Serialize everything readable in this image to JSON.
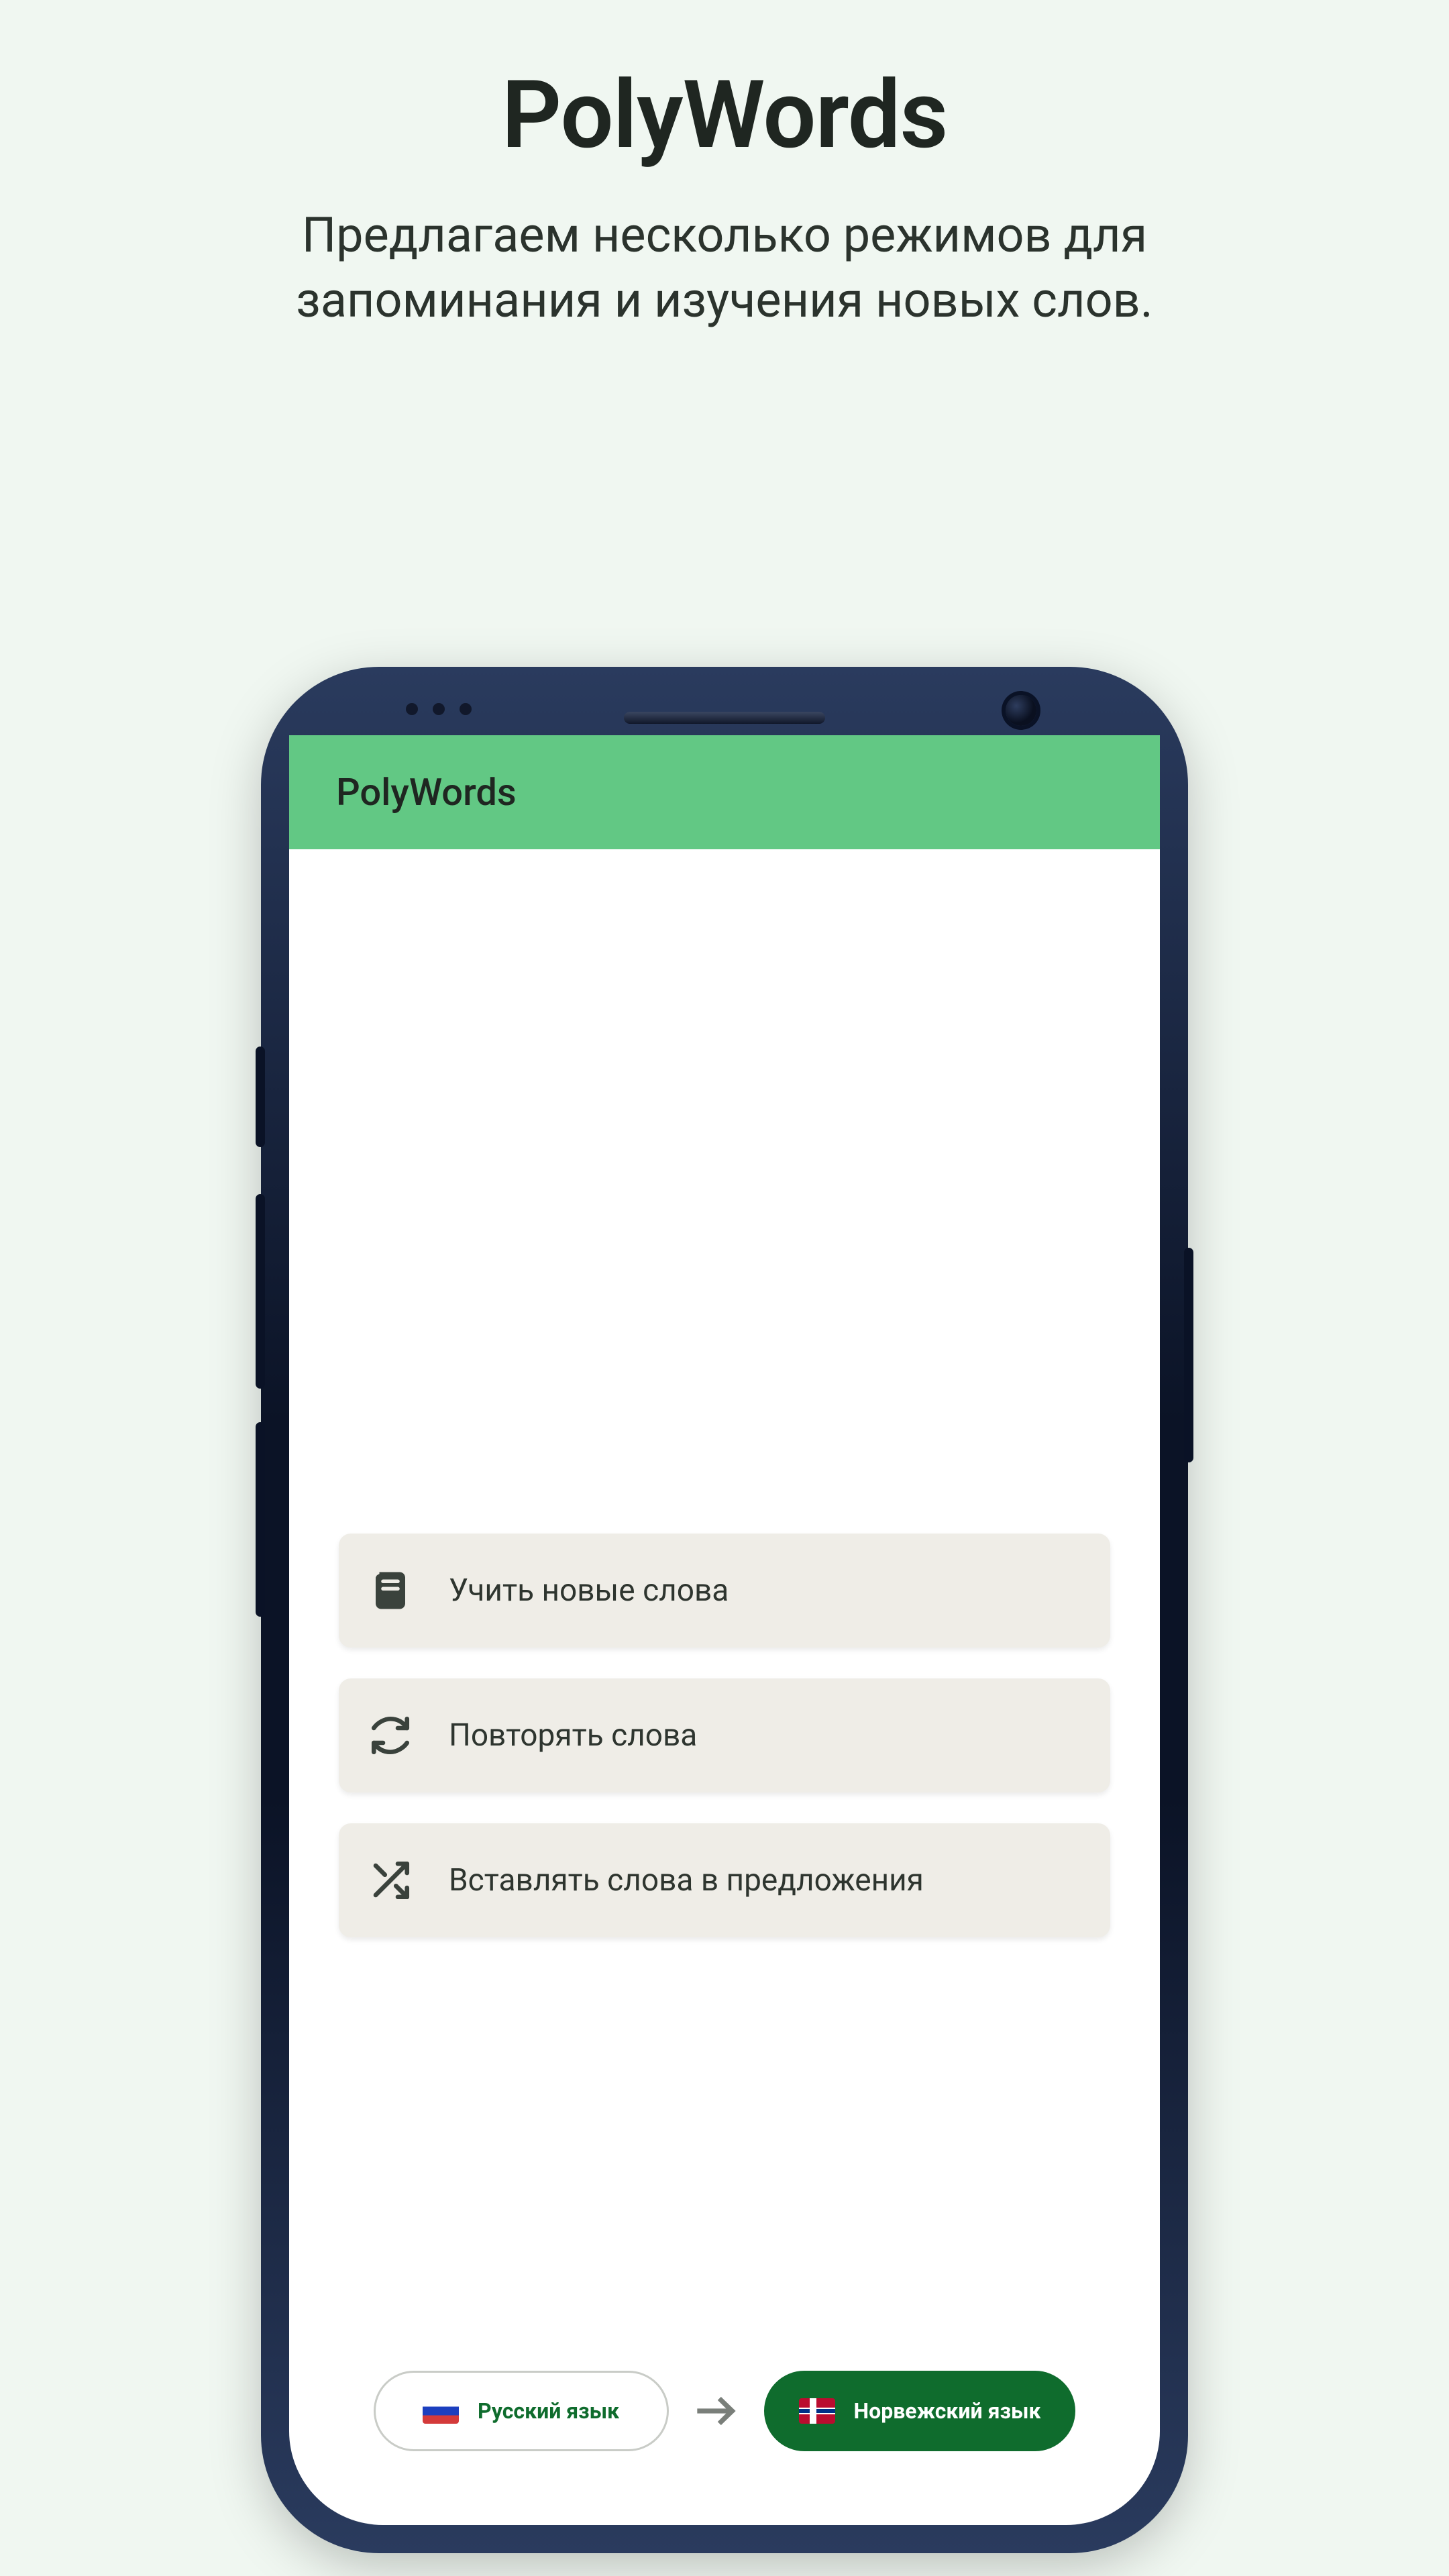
{
  "promo": {
    "title": "PolyWords",
    "subtitle": "Предлагаем несколько режимов для запоминания и изучения новых слов."
  },
  "app": {
    "appbar_title": "PolyWords",
    "modes": [
      {
        "icon": "book-icon",
        "label": "Учить новые слова"
      },
      {
        "icon": "repeat-icon",
        "label": "Повторять слова"
      },
      {
        "icon": "shuffle-icon",
        "label": "Вставлять слова в предложения"
      }
    ],
    "lang": {
      "src": {
        "flag": "ru",
        "name": "Русский язык"
      },
      "dst": {
        "flag": "no",
        "name": "Норвежский язык"
      }
    }
  },
  "colors": {
    "page_bg": "#f0f7f1",
    "appbar": "#62c884",
    "card": "#efede7",
    "accent": "#0f6c2d"
  }
}
